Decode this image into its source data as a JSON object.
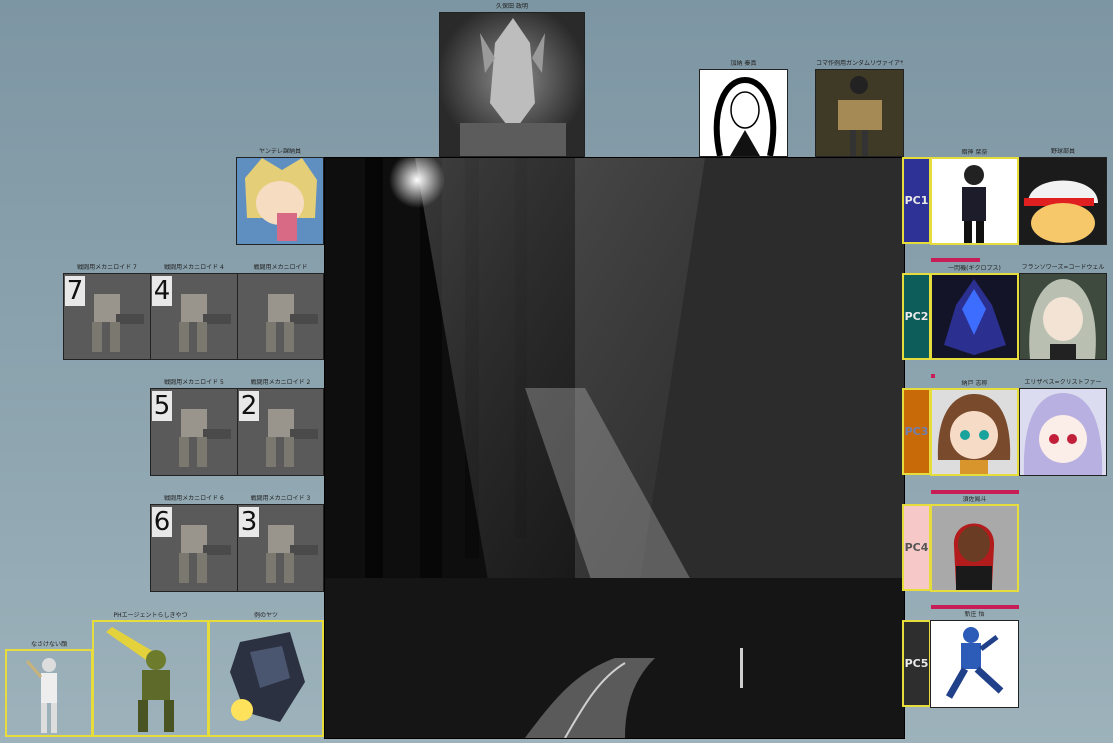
{
  "colors": {
    "background": "#8aa2ad",
    "token_border": "#e6dc3c",
    "hp_bar": "#c81e58",
    "pc1": "#2e3196",
    "pc2": "#0d5e5a",
    "pc3": "#c96a08",
    "pc4": "#f6c8c8",
    "pc5": "#2e2e2e"
  },
  "top_tokens": {
    "boss": "久保田 政明",
    "kano": "加納 秦真",
    "koma": "コマ作例用ガンダムリヴァイアサン"
  },
  "left_tokens": {
    "yandere": "ヤンデレ課納員",
    "mecha": [
      {
        "name": "戦闘用メカニロイド 7",
        "number": "7"
      },
      {
        "name": "戦闘用メカニロイド 4",
        "number": "4"
      },
      {
        "name": "戦闘用メカニロイド",
        "number": ""
      },
      {
        "name": "戦闘用メカニロイド 5",
        "number": "5"
      },
      {
        "name": "戦闘用メカニロイド 2",
        "number": "2"
      },
      {
        "name": "戦闘用メカニロイド 6",
        "number": "6"
      },
      {
        "name": "戦闘用メカニロイド 3",
        "number": "3"
      }
    ],
    "nakekenai": "なさけない顔",
    "ph_agent": "PHエージェントらしきやつ",
    "kurai": "例のヤツ"
  },
  "pcs": [
    {
      "label": "PC1",
      "char1": "暗神 栞奈",
      "char2": "野球部員"
    },
    {
      "label": "PC2",
      "char1": "一閃機(ギクロプス)",
      "char2": "フランソワーズ=コードウェル"
    },
    {
      "label": "PC3",
      "char1": "納戸 志称",
      "char2": "エリザベス=クリストファー"
    },
    {
      "label": "PC4",
      "char1": "須佐鳳斗"
    },
    {
      "label": "PC5",
      "char1": "新庄 悟"
    }
  ],
  "hp": [
    0.0,
    0.55,
    0.05,
    1.0,
    1.0
  ]
}
